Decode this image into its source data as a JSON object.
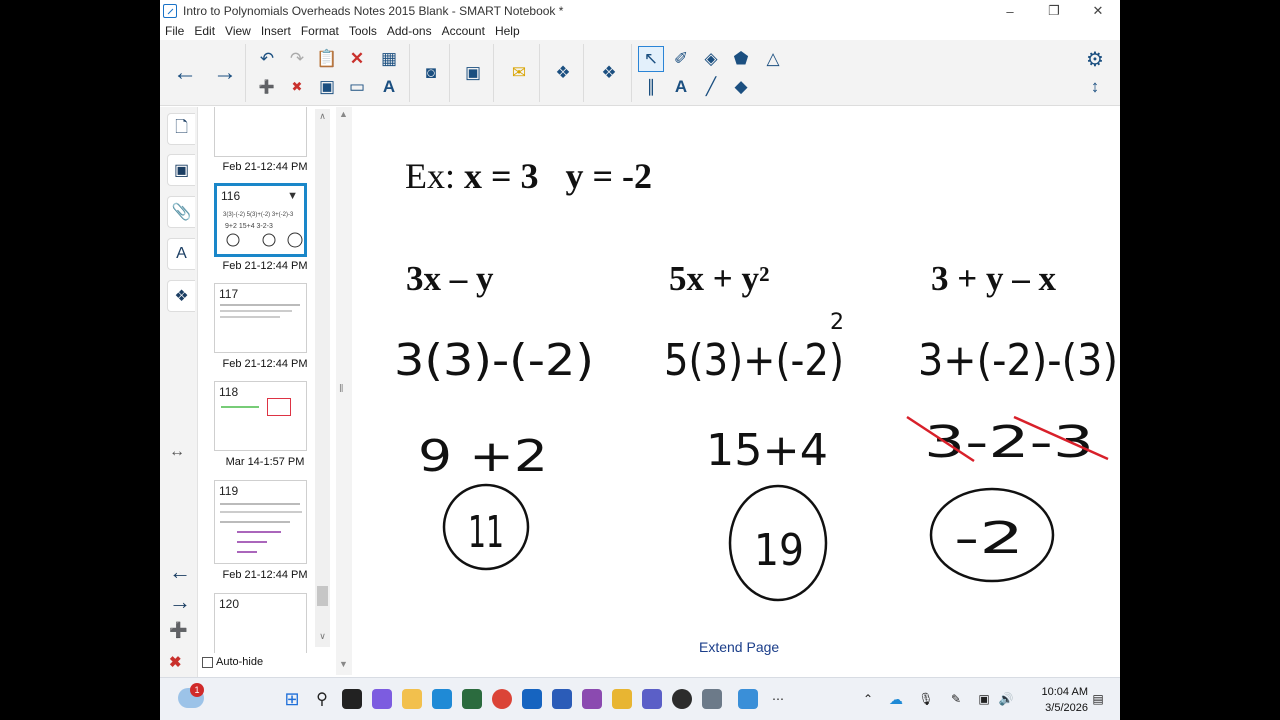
{
  "window": {
    "title": "Intro to Polynomials Overheads Notes 2015 Blank - SMART Notebook *",
    "minimize": "–",
    "maximize": "❐",
    "close": "✕"
  },
  "menu": [
    "File",
    "Edit",
    "View",
    "Insert",
    "Format",
    "Tools",
    "Add-ons",
    "Account",
    "Help"
  ],
  "toolbar_icons": {
    "back": "←",
    "forward": "→",
    "undo": "↶",
    "redo": "↷",
    "delete": "✕",
    "table": "▦",
    "add_page": "➕",
    "remove_page": "✖",
    "save": "▣",
    "screen": "▭",
    "handwriting": "A",
    "camera": "◙",
    "doc_camera": "▣",
    "response": "✉",
    "addons": "❖",
    "widget": "❖",
    "select": "↖",
    "pens": "✐",
    "shapes": "◈",
    "fill": "⬟",
    "paint": "△",
    "measure": "∥",
    "text": "A",
    "line": "╱",
    "eraser": "◆",
    "settings": "⚙",
    "move": "↕"
  },
  "sorter": {
    "pages": [
      {
        "num": "",
        "label": "Feb 21-12:44 PM",
        "selected": false
      },
      {
        "num": "116",
        "label": "Feb 21-12:44 PM",
        "selected": true
      },
      {
        "num": "117",
        "label": "Feb 21-12:44 PM",
        "selected": false
      },
      {
        "num": "118",
        "label": "Mar 14-1:57 PM",
        "selected": false
      },
      {
        "num": "119",
        "label": "Feb 21-12:44 PM",
        "selected": false
      },
      {
        "num": "120",
        "label": "",
        "selected": false
      }
    ],
    "autohide_label": "Auto-hide"
  },
  "slide": {
    "example_prefix": "Ex: ",
    "example_vars": "x = 3   y = -2",
    "expressions": [
      "3x – y",
      "5x + y²",
      "3 + y – x"
    ],
    "handwritten": {
      "col1": [
        "3(3)-(-2)",
        "9 +2",
        "11"
      ],
      "col2": [
        "5(3)+(-2)",
        "2",
        "15+4",
        "19"
      ],
      "col3": [
        "3+(-2)-(3)",
        "3-2-3",
        "-2"
      ]
    },
    "extend_link": "Extend Page"
  },
  "taskbar": {
    "notification_badge": "1",
    "time": "10:04 AM",
    "date": "3/5/2026"
  }
}
